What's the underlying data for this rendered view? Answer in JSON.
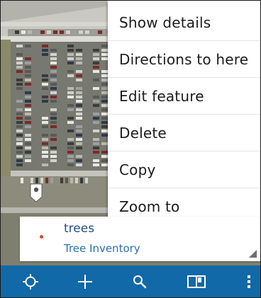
{
  "context_menu": {
    "items": [
      {
        "label": "Show details"
      },
      {
        "label": "Directions to here"
      },
      {
        "label": "Edit feature"
      },
      {
        "label": "Delete"
      },
      {
        "label": "Copy"
      },
      {
        "label": "Zoom to"
      }
    ]
  },
  "callout": {
    "title": "trees",
    "subtitle": "Tree Inventory",
    "marker_color": "#e0452b"
  },
  "toolbar": {
    "background": "#1169a7",
    "tools": [
      {
        "icon": "locate-icon"
      },
      {
        "icon": "add-icon"
      },
      {
        "icon": "search-icon"
      },
      {
        "icon": "map-book-icon"
      },
      {
        "icon": "overflow-menu-icon"
      }
    ]
  },
  "map": {
    "type": "satellite imagery"
  }
}
